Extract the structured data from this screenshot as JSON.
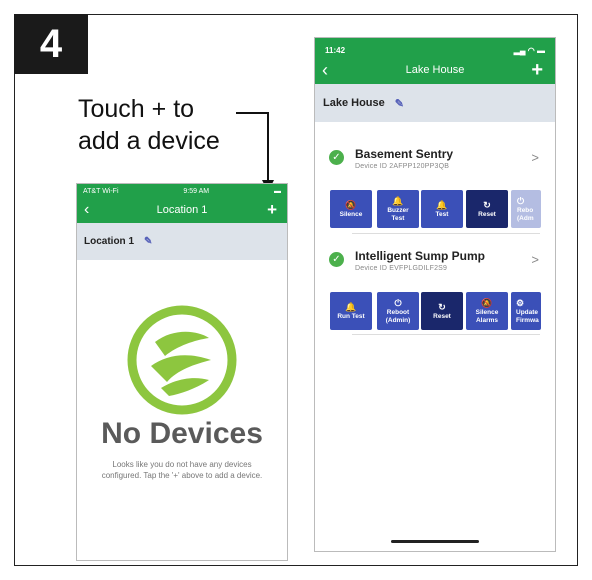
{
  "step_number": "4",
  "instruction": {
    "line1": "Touch + to",
    "line2": "add a device"
  },
  "phone1": {
    "status": {
      "carrier": "AT&T Wi-Fi",
      "time": "9:59 AM"
    },
    "nav": {
      "title": "Location 1",
      "back": "‹",
      "add": "+"
    },
    "location_name": "Location 1",
    "empty_title": "No Devices",
    "empty_message_line1": "Looks like you do not have any devices",
    "empty_message_line2": "configured. Tap the '+' above to add a device."
  },
  "phone2": {
    "status": {
      "time": "11:42"
    },
    "nav": {
      "title": "Lake House",
      "back": "‹",
      "add": "+"
    },
    "location_name": "Lake House",
    "devices": [
      {
        "name": "Basement Sentry",
        "device_id": "Device ID 2AFPP120PP3QB",
        "buttons": [
          {
            "line1": "Silence",
            "line2": ""
          },
          {
            "line1": "Buzzer",
            "line2": "Test"
          },
          {
            "line1": "Test",
            "line2": ""
          },
          {
            "line1": "Reset",
            "line2": ""
          },
          {
            "line1": "Rebo",
            "line2": "(Adm"
          }
        ]
      },
      {
        "name": "Intelligent Sump Pump",
        "device_id": "Device ID EVFPLGDILF2S9",
        "buttons": [
          {
            "line1": "Run Test",
            "line2": ""
          },
          {
            "line1": "Reboot",
            "line2": "(Admin)"
          },
          {
            "line1": "Reset",
            "line2": ""
          },
          {
            "line1": "Silence",
            "line2": "Alarms"
          },
          {
            "line1": "Update",
            "line2": "Firmwa"
          }
        ]
      }
    ]
  },
  "colors": {
    "appbar": "#21a04a",
    "button": "#3b50b8",
    "button_dark": "#1a276b",
    "location_bar": "#dde3ea"
  }
}
